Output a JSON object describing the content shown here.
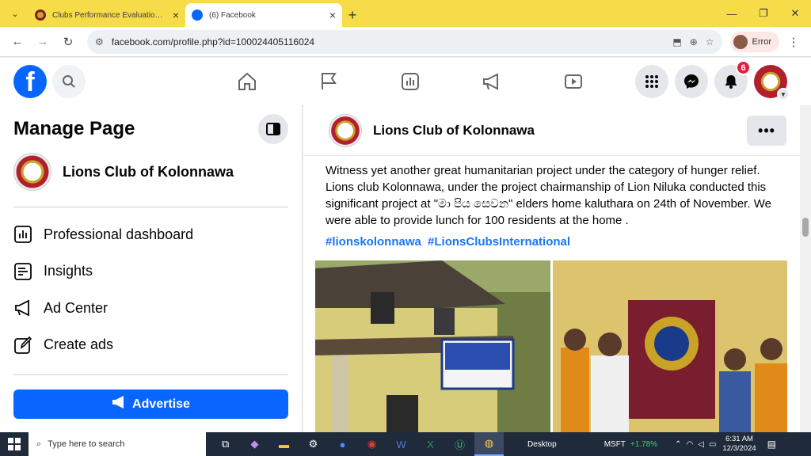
{
  "browser": {
    "tabs": [
      {
        "title": "Clubs Performance Evaluation Syst",
        "active": false
      },
      {
        "title": "(6) Facebook",
        "active": true
      }
    ],
    "url": "facebook.com/profile.php?id=100024405116024",
    "profile_label": "Error"
  },
  "fb_header": {
    "notifications_count": "6",
    "nav_icons": [
      "home-icon",
      "flag-icon",
      "analytics-icon",
      "megaphone-icon",
      "watch-icon"
    ]
  },
  "sidebar": {
    "title": "Manage Page",
    "page_name": "Lions Club of Kolonnawa",
    "items": [
      {
        "label": "Professional dashboard",
        "icon": "dashboard-icon"
      },
      {
        "label": "Insights",
        "icon": "insights-icon"
      },
      {
        "label": "Ad Center",
        "icon": "megaphone-icon"
      },
      {
        "label": "Create ads",
        "icon": "pencil-icon"
      }
    ],
    "advertise_label": "Advertise"
  },
  "post": {
    "page_name": "Lions Club of Kolonnawa",
    "more_label": "•••",
    "text": "Witness yet another great humanitarian project under the category of hunger relief. Lions club Kolonnawa, under the project chairmanship of Lion Niluka conducted this significant project at \"මා පිය සෙවන\" elders home kaluthara on 24th of November. We were able to provide lunch for 100 residents at the home .",
    "hashtags": [
      "#lionskolonnawa",
      "#LionsClubsInternational"
    ]
  },
  "taskbar": {
    "search_placeholder": "Type here to search",
    "desktop_label": "Desktop",
    "stock_symbol": "MSFT",
    "stock_change": "+1.78%",
    "time": "6:31 AM",
    "date": "12/3/2024"
  },
  "colors": {
    "fb_blue": "#0866ff",
    "tabbar_yellow": "#f7dc4a",
    "badge_red": "#e41e3f",
    "hashtag_blue": "#1877f2"
  }
}
